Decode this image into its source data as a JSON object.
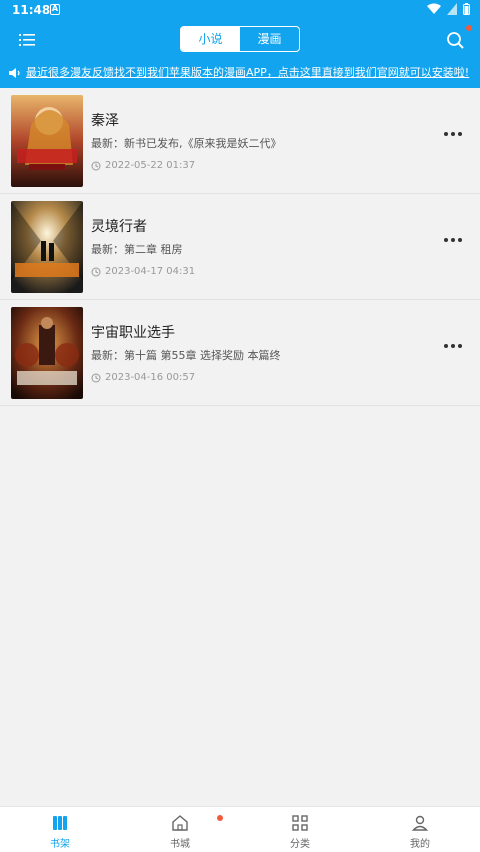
{
  "status": {
    "time": "11:48",
    "notify_icon": "A"
  },
  "header": {
    "tabs": [
      {
        "label": "小说",
        "active": true
      },
      {
        "label": "漫画",
        "active": false
      }
    ],
    "notice": "最近很多漫友反馈找不到我们苹果版本的漫画APP，点击这里直接到我们官网就可以安装啦!"
  },
  "books": [
    {
      "title": "秦泽",
      "latest": "最新：新书已发布,《原来我是妖二代》",
      "time": "2022-05-22 01:37"
    },
    {
      "title": "灵境行者",
      "latest": "最新：第二章 租房",
      "time": "2023-04-17 04:31"
    },
    {
      "title": "宇宙职业选手",
      "latest": "最新：第十篇 第55章 选择奖励 本篇终",
      "time": "2023-04-16 00:57"
    }
  ],
  "bottom_nav": [
    {
      "label": "书架",
      "icon": "bookshelf-icon",
      "active": true
    },
    {
      "label": "书城",
      "icon": "home-icon",
      "active": false
    },
    {
      "label": "分类",
      "icon": "grid-icon",
      "active": false
    },
    {
      "label": "我的",
      "icon": "user-icon",
      "active": false
    }
  ],
  "colors": {
    "primary": "#12a4ef",
    "badge": "#f15a3a",
    "background": "#f2f2f2"
  }
}
